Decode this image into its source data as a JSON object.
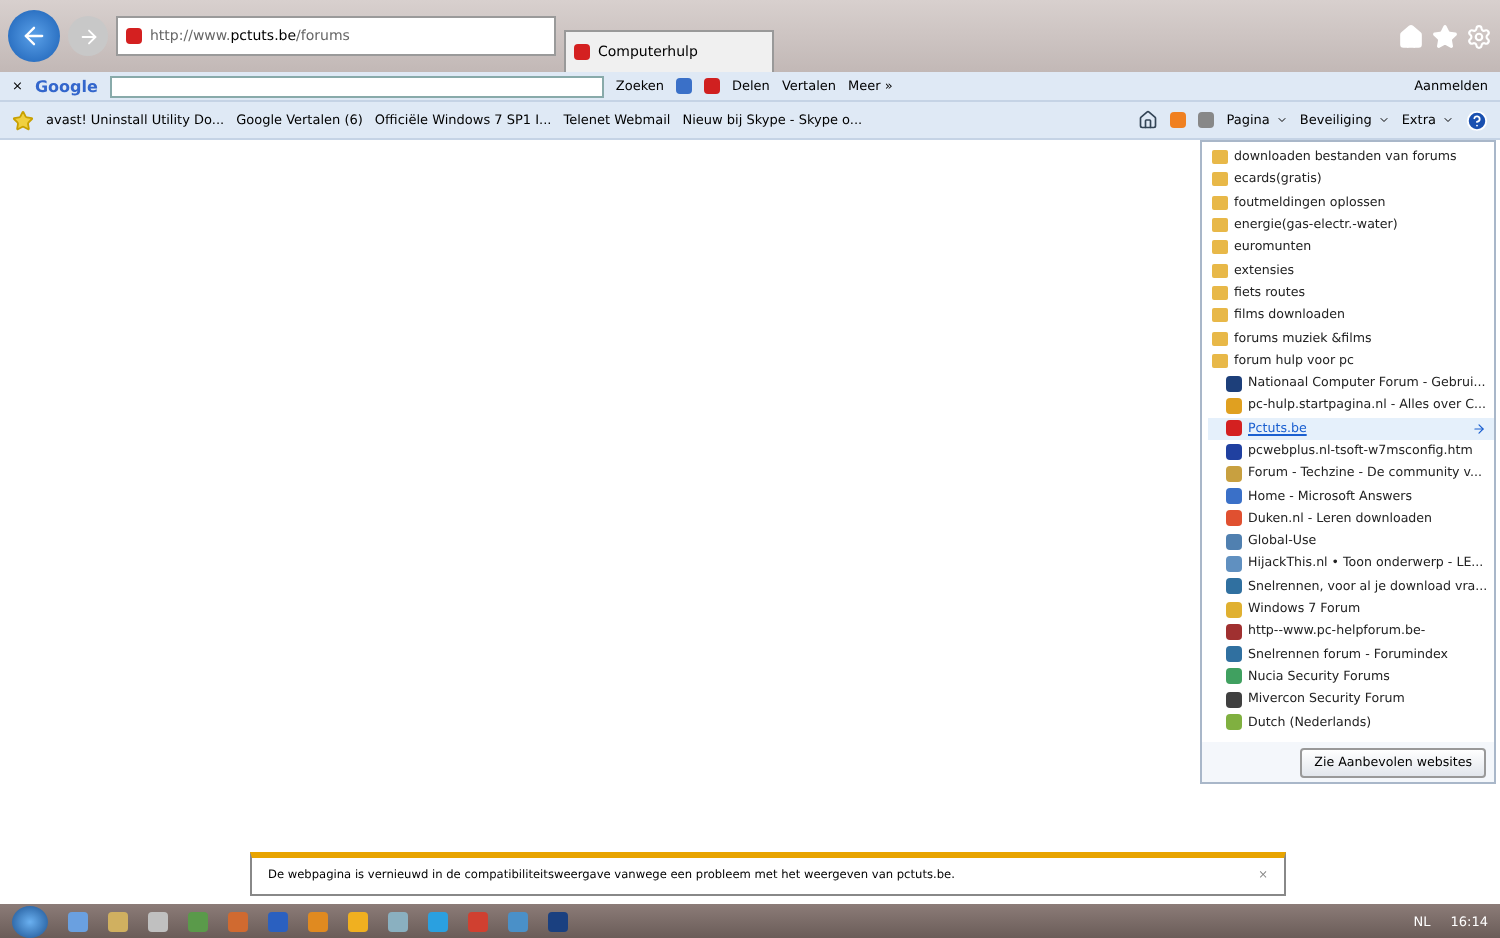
{
  "address_bar": {
    "url_prefix": "http://www.",
    "url_host": "pctuts.be",
    "url_path": "/forums"
  },
  "tab": {
    "title": "Computerhulp",
    "selected": true
  },
  "google_bar": {
    "close": "×",
    "logo": "Google",
    "search": "Zoeken",
    "share": "Delen",
    "translate": "Vertalen",
    "more": "Meer »",
    "sign_in": "Aanmelden"
  },
  "favorites_bar": [
    "avast! Uninstall Utility  Do...",
    "Google Vertalen (6)",
    "Officiële Windows 7 SP1 I...",
    "Telenet Webmail",
    "Nieuw bij Skype - Skype o..."
  ],
  "command_bar": [
    "Pagina",
    "Beveiliging",
    "Extra"
  ],
  "favorites_panel": {
    "items": [
      {
        "kind": "folder",
        "label": "downloaden bestanden van forums",
        "expanded": false
      },
      {
        "kind": "folder",
        "label": "ecards(gratis)",
        "expanded": false
      },
      {
        "kind": "folder",
        "label": "foutmeldingen oplossen",
        "expanded": false
      },
      {
        "kind": "folder",
        "label": "energie(gas-electr.-water)",
        "expanded": false
      },
      {
        "kind": "folder",
        "label": "euromunten",
        "expanded": false
      },
      {
        "kind": "folder",
        "label": "extensies",
        "expanded": false
      },
      {
        "kind": "folder",
        "label": "fiets routes",
        "expanded": false
      },
      {
        "kind": "folder",
        "label": "films downloaden",
        "expanded": false
      },
      {
        "kind": "folder",
        "label": "forums muziek &films",
        "expanded": false
      },
      {
        "kind": "folder",
        "label": "forum hulp voor pc",
        "expanded": true,
        "children": [
          {
            "kind": "site",
            "label": "Nationaal Computer Forum - Gebrui...",
            "selected": false,
            "color": "#1d3f7a"
          },
          {
            "kind": "site",
            "label": "pc-hulp.startpagina.nl - Alles over C...",
            "selected": false,
            "color": "#e0a020"
          },
          {
            "kind": "site",
            "label": "Pctuts.be",
            "selected": true,
            "color": "#d42020"
          },
          {
            "kind": "site",
            "label": "pcwebplus.nl-tsoft-w7msconfig.htm",
            "selected": false,
            "color": "#2040a0"
          },
          {
            "kind": "site",
            "label": "Forum - Techzine - De community v...",
            "selected": false,
            "color": "#c8a040"
          },
          {
            "kind": "site",
            "label": "Home - Microsoft Answers",
            "selected": false,
            "color": "#3a70c8"
          },
          {
            "kind": "site",
            "label": "Duken.nl - Leren downloaden",
            "selected": false,
            "color": "#e05030"
          },
          {
            "kind": "site",
            "label": "Global-Use",
            "selected": false,
            "color": "#5080b0"
          },
          {
            "kind": "site",
            "label": "HijackThis.nl • Toon onderwerp - LE...",
            "selected": false,
            "color": "#6090c0"
          },
          {
            "kind": "site",
            "label": "Snelrennen, voor al je download vra...",
            "selected": false,
            "color": "#3070a0"
          },
          {
            "kind": "site",
            "label": "Windows 7 Forum",
            "selected": false,
            "color": "#e0b030"
          },
          {
            "kind": "site",
            "label": "http--www.pc-helpforum.be-",
            "selected": false,
            "color": "#a03030"
          },
          {
            "kind": "site",
            "label": "Snelrennen forum - Forumindex",
            "selected": false,
            "color": "#3070a0"
          },
          {
            "kind": "site",
            "label": "Nucia Security Forums",
            "selected": false,
            "color": "#40a060"
          },
          {
            "kind": "site",
            "label": "Mivercon Security Forum",
            "selected": false,
            "color": "#404040"
          },
          {
            "kind": "site",
            "label": "Dutch (Nederlands)",
            "selected": false,
            "color": "#80b040"
          }
        ]
      }
    ],
    "button": "Zie Aanbevolen websites"
  },
  "notification": {
    "text": "De webpagina is vernieuwd in de compatibiliteitsweergave vanwege een probleem met het weergeven van pctuts.be.",
    "close": "×"
  },
  "taskbar": {
    "language": "NL",
    "time": "16:14"
  }
}
